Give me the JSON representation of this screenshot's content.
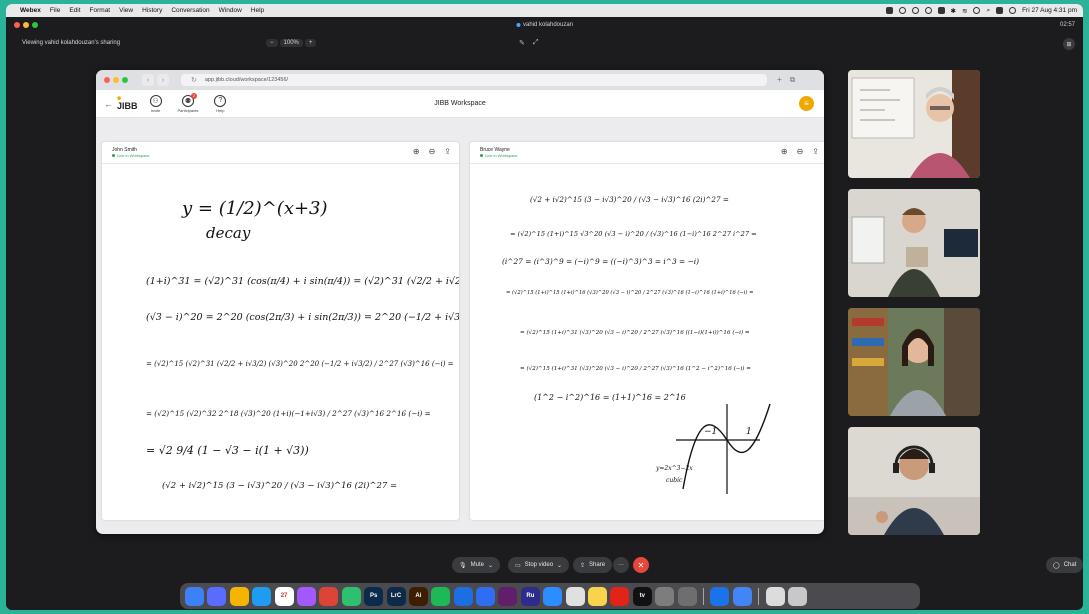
{
  "menubar": {
    "app": "Webex",
    "items": [
      "File",
      "Edit",
      "Format",
      "View",
      "History",
      "Conversation",
      "Window",
      "Help"
    ],
    "datetime": "Fri 27 Aug 4:31 pm"
  },
  "meeting": {
    "host_user": "vahid kolahdouzan",
    "timer": "02:57",
    "viewing": "Viewing vahid kolahdouzan's sharing",
    "zoom": "100%",
    "zoom_minus": "−",
    "zoom_plus": "+"
  },
  "browser": {
    "url": "app.jibb.cloud/workspace/123456/"
  },
  "jibb": {
    "logo": "JIBB",
    "title": "JIBB Workspace",
    "tools": [
      {
        "label": "Invite",
        "icon": "invite-icon"
      },
      {
        "label": "Participants",
        "icon": "participants-icon",
        "badge": "2"
      },
      {
        "label": "Help",
        "icon": "help-icon"
      }
    ]
  },
  "panels": [
    {
      "name": "John Smith",
      "status": "Live in Workspace",
      "lines": [
        "y = (1/2)^(x+3)",
        "decay",
        "(1+i)^31 = (√2)^31 (cos(π/4) + i sin(π/4)) = (√2)^31 (√2/2 + i√2/2)",
        "(√3 − i)^20 = 2^20 (cos(2π/3) + i sin(2π/3)) = 2^20 (−1/2 + i√3/2)",
        "= (√2)^15 (√2)^31 (√2/2 + i√3/2) (√3)^20 2^20 (−1/2 + i√3/2) / 2^27 (√3)^16 (−i) =",
        "= (√2)^15 (√2)^32 2^18 (√3)^20 (1+i)(−1+i√3) / 2^27 (√3)^16 2^16 (−i) =",
        "= √2 9/4 (1 − √3 − i(1 + √3))",
        "(√2 + i√2)^15 (3 − i√3)^20 / (√3 − i√3)^16 (2i)^27 ="
      ]
    },
    {
      "name": "Bruce Wayne",
      "status": "Live in Workspace",
      "lines": [
        "(√2 + i√2)^15 (3 − i√3)^20 / (√3 − i√3)^16 (2i)^27 =",
        "= (√2)^15 (1+i)^15 √3^20 (√3 − i)^20 / (√3)^16 (1−i)^16 2^27 i^27 =",
        "(i^27 = (i^3)^9 = (−i)^9 = ((−i)^3)^3 = i^3 = −i)",
        "= (√2)^15 (1+i)^15 (1+i)^16 (√3)^20 (√3 − i)^20 / 2^27 (√3)^16 (1−i)^16 (1+i)^16 (−i) =",
        "= (√2)^15 (1+i)^31 (√3)^20 (√3 − i)^20 / 2^27 (√3)^16 ((1−i)(1+i))^16 (−i) =",
        "= (√2)^15 (1+i)^31 (√3)^20 (√3 − i)^20 / 2^27 (√3)^16 (1^2 − i^2)^16 (−i) =",
        "(1^2 − i^2)^16 = (1+1)^16 = 2^16",
        "y=2x^3−2x",
        "cubic",
        "−1",
        "1"
      ]
    }
  ],
  "controls": {
    "mute": "Mute",
    "stop_video": "Stop video",
    "share": "Share",
    "more": "···",
    "chat": "Chat"
  },
  "dock": [
    {
      "label": "",
      "color": "#3c82f6"
    },
    {
      "label": "",
      "color": "#5a6cff"
    },
    {
      "label": "",
      "color": "#f4b400"
    },
    {
      "label": "",
      "color": "#1f9cf0"
    },
    {
      "label": "27",
      "color": "#ffffff"
    },
    {
      "label": "",
      "color": "#a259ff"
    },
    {
      "label": "",
      "color": "#db4437"
    },
    {
      "label": "",
      "color": "#2fbf71"
    },
    {
      "label": "Ps",
      "color": "#0b2b4c"
    },
    {
      "label": "LrC",
      "color": "#0e2a47"
    },
    {
      "label": "Ai",
      "color": "#3d1f00"
    },
    {
      "label": "",
      "color": "#1db954"
    },
    {
      "label": "",
      "color": "#1b6fe0"
    },
    {
      "label": "",
      "color": "#2f6ef2"
    },
    {
      "label": "",
      "color": "#611f69"
    },
    {
      "label": "Ru",
      "color": "#2d2b8c"
    },
    {
      "label": "",
      "color": "#2d8cff"
    },
    {
      "label": "",
      "color": "#e0e0e0"
    },
    {
      "label": "",
      "color": "#f7d44c"
    },
    {
      "label": "",
      "color": "#e2231a"
    },
    {
      "label": "tv",
      "color": "#111111"
    },
    {
      "label": "",
      "color": "#7d7d7d"
    },
    {
      "label": "",
      "color": "#6e6e6e"
    },
    {
      "label": "",
      "color": "#1a73e8"
    },
    {
      "label": "",
      "color": "#4285f4"
    },
    {
      "label": "",
      "color": "#dcdcdc"
    },
    {
      "label": "",
      "color": "#c8c8c8"
    }
  ],
  "colors": {
    "accent_orange": "#f0a800",
    "end_call_red": "#e5483a",
    "live_green": "#2ba44b"
  }
}
